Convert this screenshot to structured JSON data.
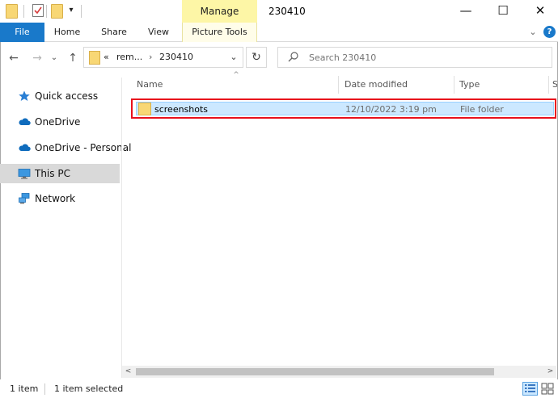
{
  "window": {
    "title": "230410",
    "manage_tab": "Manage",
    "minimize_glyph": "—",
    "maximize_glyph": "☐",
    "close_glyph": "✕"
  },
  "ribbon": {
    "file": "File",
    "home": "Home",
    "share": "Share",
    "view": "View",
    "picture_tools": "Picture Tools",
    "expand_glyph": "⌄",
    "help_glyph": "?"
  },
  "nav": {
    "back_glyph": "←",
    "forward_glyph": "→",
    "recent_glyph": "⌄",
    "up_glyph": "↑",
    "refresh_glyph": "↻",
    "address": {
      "overflow": "«",
      "crumb1": "rem...",
      "separator": "›",
      "crumb2": "230410",
      "dropdown_glyph": "⌄"
    },
    "search_placeholder": "Search 230410"
  },
  "sidebar": {
    "items": [
      {
        "label": "Quick access",
        "icon": "star-icon"
      },
      {
        "label": "OneDrive",
        "icon": "cloud-icon"
      },
      {
        "label": "OneDrive - Personal",
        "icon": "cloud-icon"
      },
      {
        "label": "This PC",
        "icon": "monitor-icon",
        "selected": true
      },
      {
        "label": "Network",
        "icon": "network-icon"
      }
    ]
  },
  "columns": {
    "name": "Name",
    "date_modified": "Date modified",
    "type": "Type",
    "size_cut": "S",
    "sort_glyph": "^"
  },
  "files": [
    {
      "name": "screenshots",
      "date_modified": "12/10/2022 3:19 pm",
      "type": "File folder"
    }
  ],
  "scrollbar": {
    "left_glyph": "<",
    "right_glyph": ">"
  },
  "status": {
    "item_count": "1 item",
    "selected_count": "1 item selected"
  },
  "colors": {
    "accent": "#1979ca",
    "manage_highlight": "#fdf6a6",
    "selection": "#cce8ff",
    "annotation_border": "#e8101c",
    "folder": "#f8d775"
  }
}
